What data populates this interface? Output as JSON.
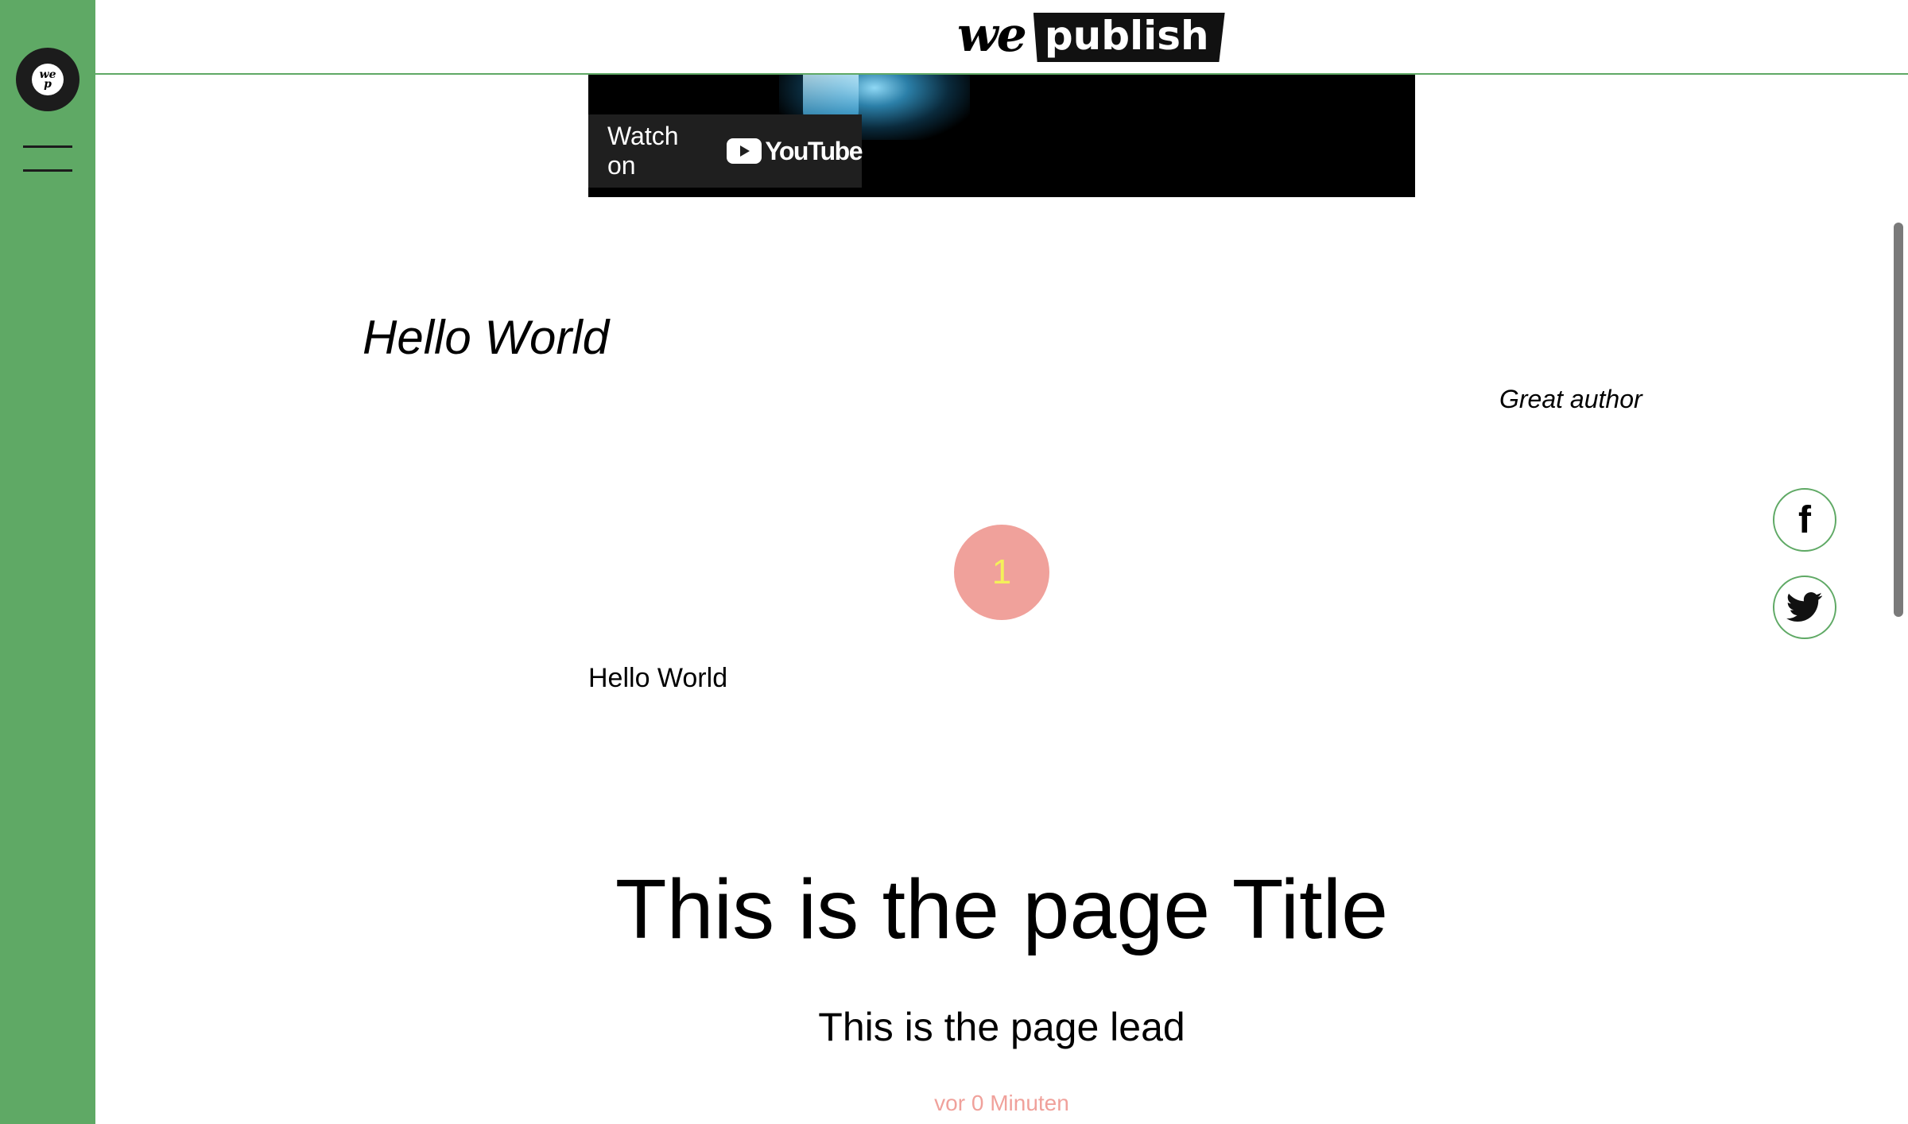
{
  "header": {
    "brand_we": "we",
    "brand_publish": "publish"
  },
  "sidebar": {
    "logo_top": "we",
    "logo_bottom": "p"
  },
  "video": {
    "watch_on": "Watch on",
    "platform": "YouTube"
  },
  "article": {
    "quote_title": "Hello World",
    "author": "Great author",
    "badge_number": "1",
    "text": "Hello World"
  },
  "page": {
    "title": "This is the page Title",
    "lead": "This is the page lead",
    "date": "vor 0 Minuten"
  },
  "social": {
    "facebook_glyph": "f"
  },
  "colors": {
    "sidebar": "#5fa965",
    "accent_pink": "#f0a19b",
    "badge_number": "#f4f05a"
  }
}
